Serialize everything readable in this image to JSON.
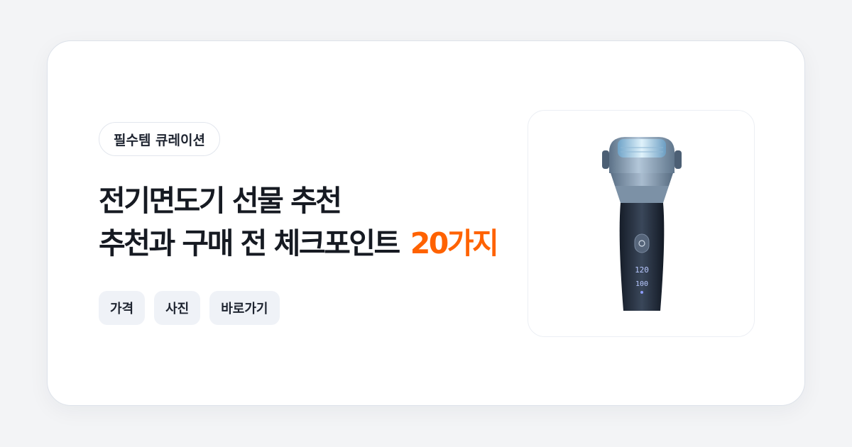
{
  "badge": {
    "label": "필수템 큐레이션"
  },
  "headline": {
    "line1": "전기면도기 선물 추천",
    "line2": "추천과 구매 전 체크포인트",
    "accent": "20가지"
  },
  "chips": [
    {
      "label": "가격"
    },
    {
      "label": "사진"
    },
    {
      "label": "바로가기"
    }
  ],
  "product": {
    "display_top": "120",
    "display_bottom": "100",
    "icon": "electric-shaver"
  },
  "colors": {
    "accent": "#ff6200",
    "background": "#f3f4f6",
    "card": "#ffffff",
    "chip_bg": "#eff2f7"
  }
}
